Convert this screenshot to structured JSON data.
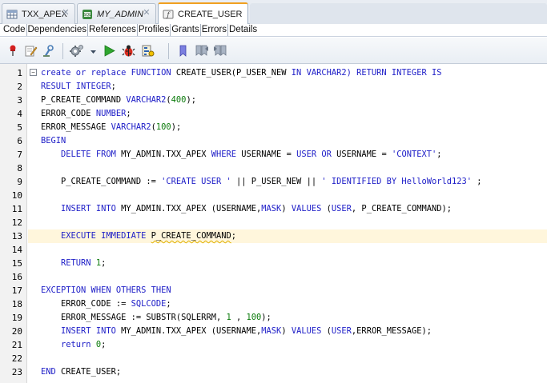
{
  "doc_tabs": [
    {
      "label": "TXX_APEX",
      "icon": "table-icon",
      "italic": false,
      "active": false
    },
    {
      "label": "MY_ADMIN",
      "icon": "sql-worksheet-icon",
      "italic": true,
      "active": false
    },
    {
      "label": "CREATE_USER",
      "icon": "function-icon",
      "italic": false,
      "active": true
    }
  ],
  "sub_tabs": [
    "Code",
    "Dependencies",
    "References",
    "Profiles",
    "Grants",
    "Errors",
    "Details"
  ],
  "active_sub_tab": "Code",
  "toolbar": [
    "pin-icon",
    "edit-icon",
    "compile-icon",
    "settings-gear-icon",
    "dropdown-arrow-icon",
    "run-icon",
    "debug-icon",
    "profile-icon",
    "bookmark-icon",
    "prev-bookmark-icon",
    "next-bookmark-icon"
  ],
  "colors": {
    "keyword": "#2020c8",
    "number": "#0a7a0a",
    "current_line": "#fff6dc",
    "active_tab_accent": "#f0a020"
  },
  "current_line": 13,
  "code_lines": [
    [
      [
        "kw",
        "create or replace FUNCTION "
      ],
      [
        "t",
        "CREATE_USER(P_USER_NEW "
      ],
      [
        "kw",
        "IN VARCHAR2) RETURN INTEGER IS"
      ]
    ],
    [
      [
        "kw",
        "RESULT INTEGER"
      ],
      [
        "t",
        ";"
      ]
    ],
    [
      [
        "t",
        "P_CREATE_COMMAND "
      ],
      [
        "kw",
        "VARCHAR2"
      ],
      [
        "t",
        "("
      ],
      [
        "num",
        "400"
      ],
      [
        "t",
        ");"
      ]
    ],
    [
      [
        "t",
        "ERROR_CODE "
      ],
      [
        "kw",
        "NUMBER"
      ],
      [
        "t",
        ";"
      ]
    ],
    [
      [
        "t",
        "ERROR_MESSAGE "
      ],
      [
        "kw",
        "VARCHAR2"
      ],
      [
        "t",
        "("
      ],
      [
        "num",
        "100"
      ],
      [
        "t",
        ");"
      ]
    ],
    [
      [
        "kw",
        "BEGIN"
      ]
    ],
    [
      [
        "t",
        "    "
      ],
      [
        "kw",
        "DELETE FROM "
      ],
      [
        "t",
        "MY_ADMIN.TXX_APEX "
      ],
      [
        "kw",
        "WHERE "
      ],
      [
        "t",
        "USERNAME = "
      ],
      [
        "kw",
        "USER OR "
      ],
      [
        "t",
        "USERNAME = "
      ],
      [
        "str",
        "'CONTEXT'"
      ],
      [
        "t",
        ";"
      ]
    ],
    [],
    [
      [
        "t",
        "    P_CREATE_COMMAND := "
      ],
      [
        "str",
        "'CREATE USER '"
      ],
      [
        "t",
        " || P_USER_NEW || "
      ],
      [
        "str",
        "' IDENTIFIED BY HelloWorld123'"
      ],
      [
        "t",
        " ;"
      ]
    ],
    [],
    [
      [
        "t",
        "    "
      ],
      [
        "kw",
        "INSERT INTO "
      ],
      [
        "t",
        "MY_ADMIN.TXX_APEX (USERNAME,"
      ],
      [
        "kw",
        "MASK"
      ],
      [
        "t",
        ") "
      ],
      [
        "kw",
        "VALUES "
      ],
      [
        "t",
        "("
      ],
      [
        "kw",
        "USER"
      ],
      [
        "t",
        ", P_CREATE_COMMAND);"
      ]
    ],
    [],
    [
      [
        "t",
        "    "
      ],
      [
        "kw",
        "EXECUTE IMMEDIATE "
      ],
      [
        "sq",
        "P_CREATE_COMMAND"
      ],
      [
        "t",
        ";"
      ]
    ],
    [],
    [
      [
        "t",
        "    "
      ],
      [
        "kw",
        "RETURN "
      ],
      [
        "num",
        "1"
      ],
      [
        "t",
        ";"
      ]
    ],
    [],
    [
      [
        "kw",
        "EXCEPTION WHEN OTHERS THEN"
      ]
    ],
    [
      [
        "t",
        "    ERROR_CODE := "
      ],
      [
        "kw",
        "SQLCODE"
      ],
      [
        "t",
        ";"
      ]
    ],
    [
      [
        "t",
        "    ERROR_MESSAGE := SUBSTR(SQLERRM, "
      ],
      [
        "num",
        "1"
      ],
      [
        "t",
        " , "
      ],
      [
        "num",
        "100"
      ],
      [
        "t",
        ");"
      ]
    ],
    [
      [
        "t",
        "    "
      ],
      [
        "kw",
        "INSERT INTO "
      ],
      [
        "t",
        "MY_ADMIN.TXX_APEX (USERNAME,"
      ],
      [
        "kw",
        "MASK"
      ],
      [
        "t",
        ") "
      ],
      [
        "kw",
        "VALUES "
      ],
      [
        "t",
        "("
      ],
      [
        "kw",
        "USER"
      ],
      [
        "t",
        ",ERROR_MESSAGE);"
      ]
    ],
    [
      [
        "t",
        "    "
      ],
      [
        "kw",
        "return "
      ],
      [
        "num",
        "0"
      ],
      [
        "t",
        ";"
      ]
    ],
    [],
    [
      [
        "kw",
        "END "
      ],
      [
        "t",
        "CREATE_USER;"
      ]
    ]
  ]
}
